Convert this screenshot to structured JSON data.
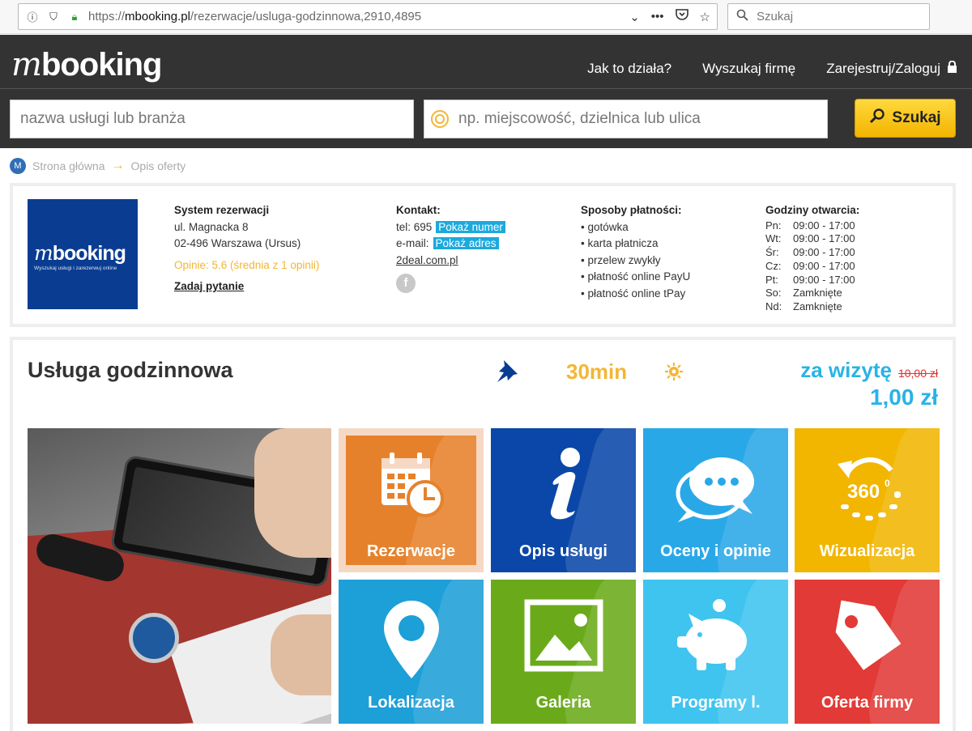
{
  "browser": {
    "url_scheme": "https://",
    "url_domain": "mbooking.pl",
    "url_path": "/rezerwacje/usluga-godzinnowa,2910,4895",
    "search_placeholder": "Szukaj",
    "actions": [
      "⌄",
      "•••"
    ]
  },
  "header": {
    "logo_m": "m",
    "logo_text": "booking",
    "nav": [
      {
        "label": "Jak to działa?"
      },
      {
        "label": "Wyszukaj firmę"
      },
      {
        "label": "Zarejestruj/Zaloguj"
      }
    ],
    "search_service_placeholder": "nazwa usługi lub branża",
    "search_location_placeholder": "np. miejscowość, dzielnica lub ulica",
    "search_button": "Szukaj"
  },
  "breadcrumb": {
    "home": "Strona główna",
    "current": "Opis oferty"
  },
  "company": {
    "logo_m": "m",
    "logo_text": "booking",
    "logo_sub": "Wyszukaj usługi i zarezerwuj online",
    "name": "System rezerwacji",
    "street": "ul. Magnacka 8",
    "city": "02-496 Warszawa (Ursus)",
    "rating": "Opinie: 5.6 (średnia z 1 opinii)",
    "ask": "Zadaj pytanie",
    "contact_title": "Kontakt:",
    "tel_label": "tel: 695",
    "tel_reveal": "Pokaż numer",
    "email_label": "e-mail:",
    "email_reveal": "Pokaż adres",
    "website": "2deal.com.pl",
    "payment_title": "Sposoby płatności:",
    "payments": [
      "• gotówka",
      "• karta płatnicza",
      "• przelew zwykły",
      "• płatność online PayU",
      "• płatność online tPay"
    ],
    "hours_title": "Godziny otwarcia:",
    "hours": [
      {
        "day": "Pn:",
        "time": "09:00 - 17:00"
      },
      {
        "day": "Wt:",
        "time": "09:00 - 17:00"
      },
      {
        "day": "Śr:",
        "time": "09:00 - 17:00"
      },
      {
        "day": "Cz:",
        "time": "09:00 - 17:00"
      },
      {
        "day": "Pt:",
        "time": "09:00 - 17:00"
      },
      {
        "day": "So:",
        "time": "Zamknięte"
      },
      {
        "day": "Nd:",
        "time": "Zamknięte"
      }
    ]
  },
  "service": {
    "title": "Usługa godzinnowa",
    "duration": "30min",
    "price_label": "za wizytę",
    "price_old": "10,00 zł",
    "price_new": "1,00 zł",
    "tiles": [
      {
        "label": "Rezerwacje"
      },
      {
        "label": "Opis usługi"
      },
      {
        "label": "Oceny i opinie"
      },
      {
        "label": "Wizualizacja"
      },
      {
        "label": "Lokalizacja"
      },
      {
        "label": "Galeria"
      },
      {
        "label": "Programy l."
      },
      {
        "label": "Oferta firmy"
      }
    ],
    "wiz_360": "360",
    "wiz_deg": "0"
  },
  "colors": {
    "header_bg": "#333333",
    "accent_yellow": "#f3b634",
    "accent_blue": "#29b3e6",
    "old_price_red": "#e0312f"
  }
}
